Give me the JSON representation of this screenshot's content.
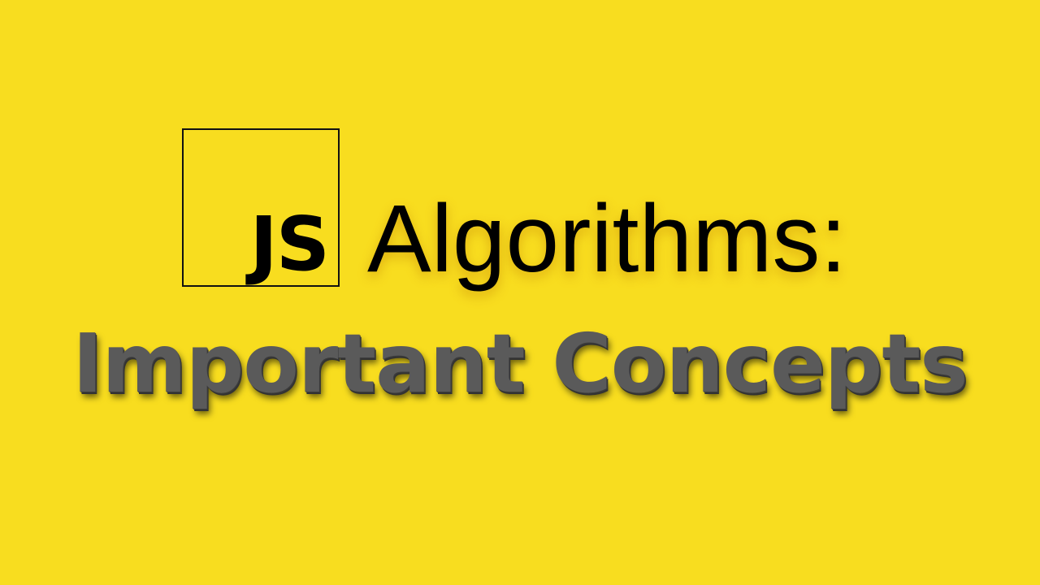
{
  "slide": {
    "background_color": "#f8dd1f",
    "logo": {
      "text": "JS"
    },
    "title": "Algorithms:",
    "subtitle": "Important Concepts",
    "subtitle_color": "#5a5a5a"
  }
}
